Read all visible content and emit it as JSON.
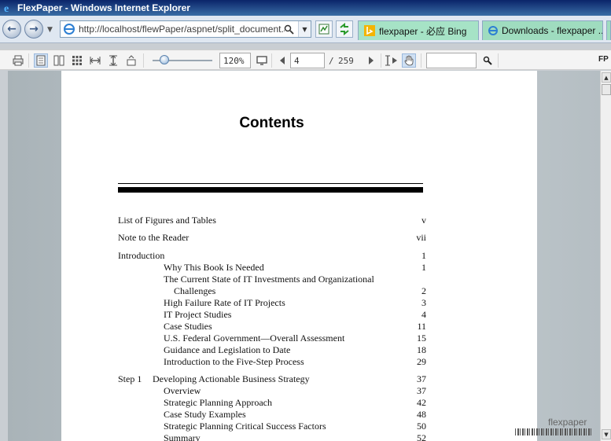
{
  "window": {
    "title": "FlexPaper - Windows Internet Explorer"
  },
  "address_bar": {
    "url": "http://localhost/flewPaper/aspnet/split_document.asp"
  },
  "tabs": [
    {
      "label": "flexpaper - 必应 Bing",
      "icon": "bing-icon"
    },
    {
      "label": "Downloads - flexpaper ...",
      "icon": "ie-icon"
    }
  ],
  "viewer_toolbar": {
    "zoom": "120%",
    "page_current": "4",
    "page_separator": "/",
    "page_total": "259",
    "search_value": "",
    "brand": "FP"
  },
  "document": {
    "heading": "Contents",
    "toc": [
      {
        "label": "List of Figures and Tables",
        "page": "v",
        "level": 0
      },
      {
        "label": "Note to the Reader",
        "page": "vii",
        "level": 0
      },
      {
        "label": "Introduction",
        "page": "1",
        "level": 0
      },
      {
        "label": "Why This Book Is Needed",
        "page": "1",
        "level": 1
      },
      {
        "label": "The Current State of IT Investments and Organizational",
        "page": "",
        "level": 1
      },
      {
        "label": "Challenges",
        "page": "2",
        "level": 2
      },
      {
        "label": "High Failure Rate of IT Projects",
        "page": "3",
        "level": 1
      },
      {
        "label": "IT Project Studies",
        "page": "4",
        "level": 1
      },
      {
        "label": "Case Studies",
        "page": "11",
        "level": 1
      },
      {
        "label": "U.S. Federal Government—Overall Assessment",
        "page": "15",
        "level": 1
      },
      {
        "label": "Guidance and Legislation to Date",
        "page": "18",
        "level": 1
      },
      {
        "label": "Introduction to the Five-Step Process",
        "page": "29",
        "level": 1
      },
      {
        "label": "Step 1",
        "page": "37",
        "level": 0,
        "sub": "Developing Actionable Business Strategy"
      },
      {
        "label": "Overview",
        "page": "37",
        "level": 1
      },
      {
        "label": "Strategic Planning Approach",
        "page": "42",
        "level": 1
      },
      {
        "label": "Case Study Examples",
        "page": "48",
        "level": 1
      },
      {
        "label": "Strategic Planning Critical Success Factors",
        "page": "50",
        "level": 1
      },
      {
        "label": "Summary",
        "page": "52",
        "level": 1
      }
    ],
    "watermark": "flexpaper"
  }
}
